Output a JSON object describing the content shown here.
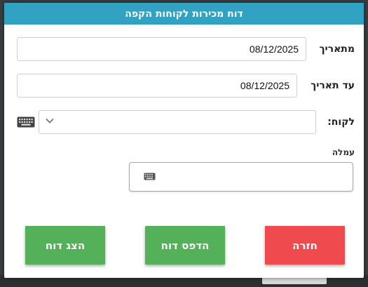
{
  "dialog": {
    "title": "דוח מכירות לקוחות הקפה"
  },
  "form": {
    "from_date_label": "מתאריך",
    "from_date_value": "08/12/2025",
    "to_date_label": "עד תאריך",
    "to_date_value": "08/12/2025",
    "customer_label": "לקוח:",
    "customer_value": "",
    "commission_label": "עמלה",
    "commission_value": ""
  },
  "buttons": {
    "show_report": "הצג דוח",
    "print_report": "הדפס דוח",
    "back": "חזרה"
  },
  "colors": {
    "header": "#32a2c3",
    "primary_button": "#55b05a",
    "back_button": "#ef4b4f"
  },
  "icons": {
    "customer_keyboard": "keyboard-icon",
    "commission_keyboard": "keyboard-icon",
    "customer_dropdown": "chevron-down-icon"
  }
}
